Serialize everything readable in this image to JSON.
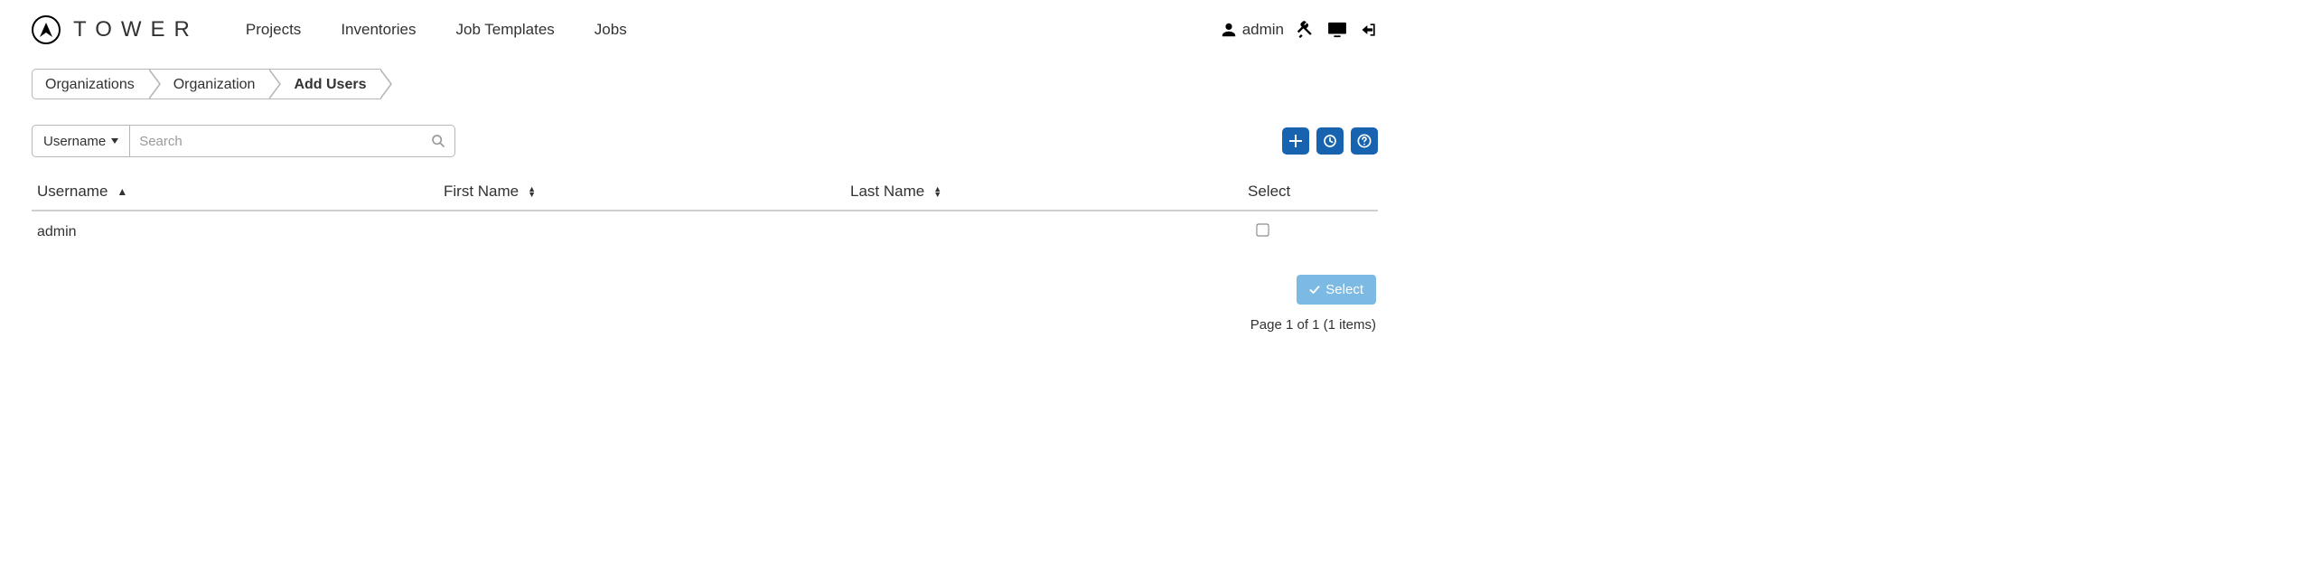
{
  "brand": {
    "title": "TOWER"
  },
  "nav": {
    "projects": "Projects",
    "inventories": "Inventories",
    "job_templates": "Job Templates",
    "jobs": "Jobs"
  },
  "user": {
    "name": "admin"
  },
  "breadcrumb": {
    "items": [
      {
        "label": "Organizations",
        "active": false
      },
      {
        "label": "Organization",
        "active": false
      },
      {
        "label": "Add Users",
        "active": true
      }
    ]
  },
  "filter": {
    "dropdown_label": "Username",
    "search_placeholder": "Search"
  },
  "table": {
    "columns": {
      "username": "Username",
      "first_name": "First Name",
      "last_name": "Last Name",
      "select": "Select"
    },
    "rows": [
      {
        "username": "admin",
        "first_name": "",
        "last_name": "",
        "selected": false
      }
    ]
  },
  "footer": {
    "select_button": "Select",
    "page_info": "Page 1 of 1 (1 items)"
  }
}
